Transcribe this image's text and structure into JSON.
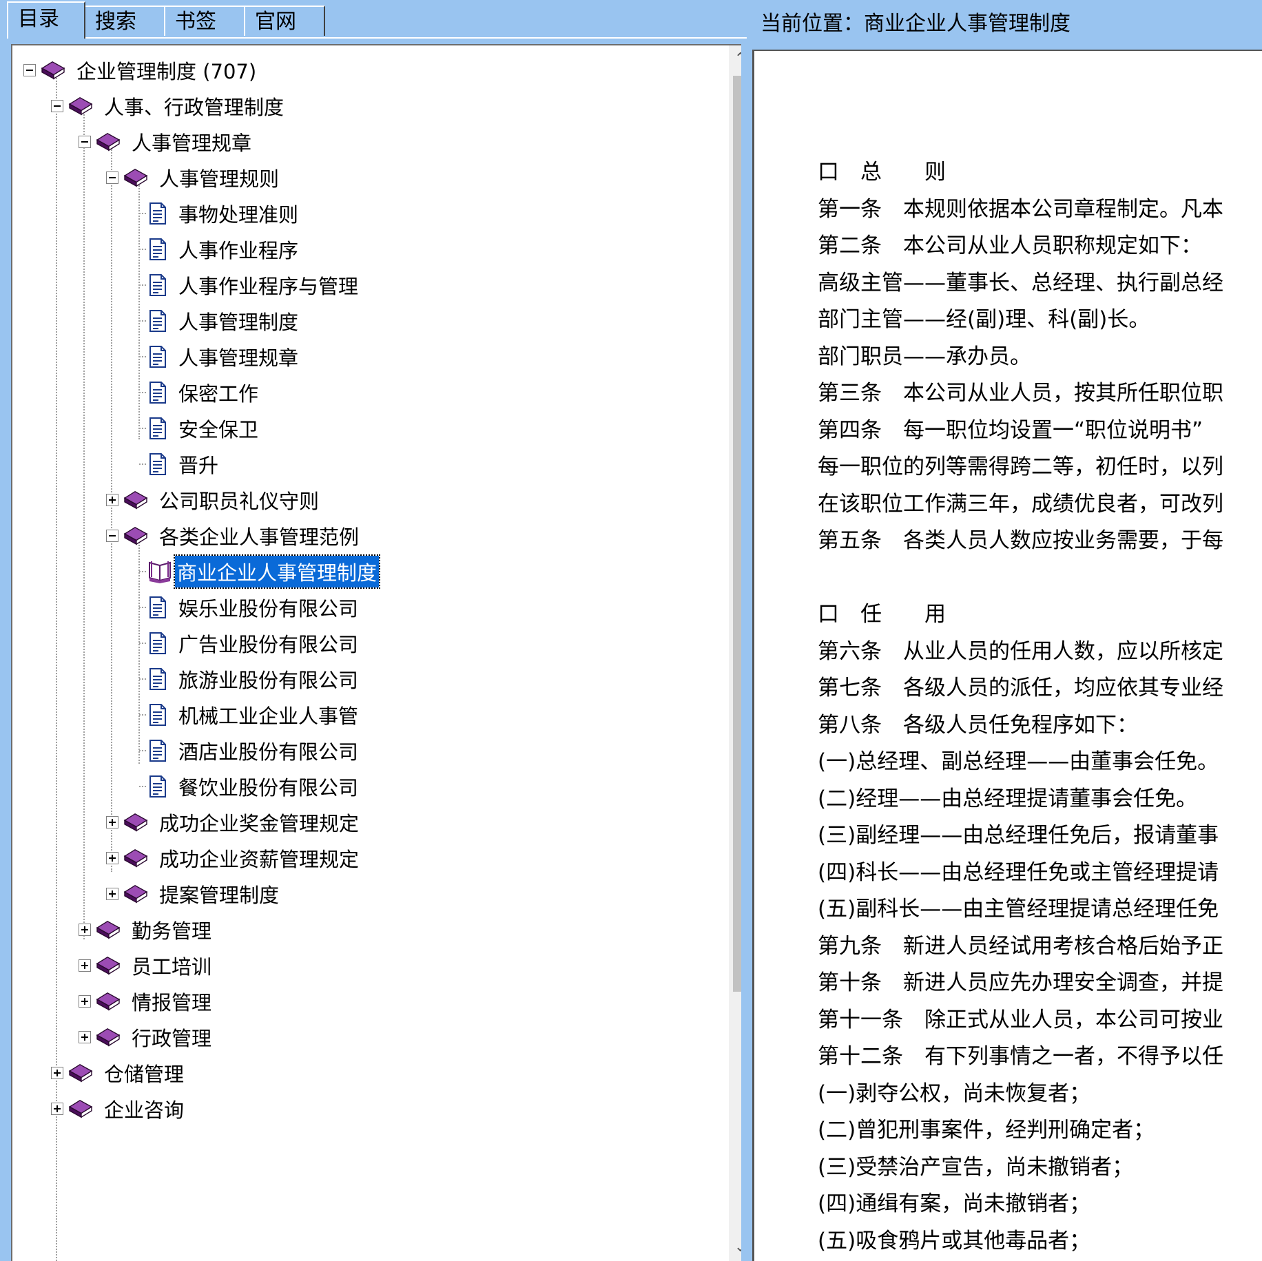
{
  "tabs": [
    {
      "label": "目录",
      "active": true
    },
    {
      "label": "搜索",
      "active": false
    },
    {
      "label": "书签",
      "active": false
    },
    {
      "label": "官网",
      "active": false
    }
  ],
  "location": {
    "prefix": "当前位置：",
    "title": "商业企业人事管理制度"
  },
  "tree": {
    "n0": "企业管理制度 (707)",
    "n1": "人事、行政管理制度",
    "n2": "人事管理规章",
    "n3": "人事管理规则",
    "n4": "事物处理准则",
    "n5": "人事作业程序",
    "n6": "人事作业程序与管理",
    "n7": "人事管理制度",
    "n8": "人事管理规章",
    "n9": "保密工作",
    "n10": "安全保卫",
    "n11": "晋升",
    "n12": "公司职员礼仪守则",
    "n13": "各类企业人事管理范例",
    "n14": "商业企业人事管理制度",
    "n15": "娱乐业股份有限公司",
    "n16": "广告业股份有限公司",
    "n17": "旅游业股份有限公司",
    "n18": "机械工业企业人事管",
    "n19": "酒店业股份有限公司",
    "n20": "餐饮业股份有限公司",
    "n21": "成功企业奖金管理规定",
    "n22": "成功企业资薪管理规定",
    "n23": "提案管理制度",
    "n24": "勤务管理",
    "n25": "员工培训",
    "n26": "情报管理",
    "n27": "行政管理",
    "n28": "仓储管理",
    "n29": "企业咨询"
  },
  "doc_lines": [
    "口　总　　则",
    "第一条　本规则依据本公司章程制定。凡本",
    "第二条　本公司从业人员职称规定如下：",
    "高级主管——董事长、总经理、执行副总经",
    "部门主管——经(副)理、科(副)长。",
    "部门职员——承办员。",
    "第三条　本公司从业人员，按其所任职位职",
    "第四条　每一职位均设置一“职位说明书”",
    "每一职位的列等需得跨二等，初任时，以列",
    "在该职位工作满三年，成绩优良者，可改列",
    "第五条　各类人员人数应按业务需要，于每",
    "",
    "口　任　　用",
    "第六条　从业人员的任用人数，应以所核定",
    "第七条　各级人员的派任，均应依其专业经",
    "第八条　各级人员任免程序如下：",
    "(一)总经理、副总经理——由董事会任免。",
    "(二)经理——由总经理提请董事会任免。",
    "(三)副经理——由总经理任免后，报请董事",
    "(四)科长——由总经理任免或主管经理提请",
    "(五)副科长——由主管经理提请总经理任免",
    "第九条　新进人员经试用考核合格后始予正",
    "第十条　新进人员应先办理安全调查，并提",
    "第十一条　除正式从业人员，本公司可按业",
    "第十二条　有下列事情之一者，不得予以任",
    "(一)剥夺公权，尚未恢复者；",
    "(二)曾犯刑事案件，经判刑确定者；",
    "(三)受禁治产宣告，尚未撤销者；",
    "(四)通缉有案，尚未撤销者；",
    "(五)吸食鸦片或其他毒品者；"
  ],
  "colors": {
    "panel": "#99c4f0",
    "book": "#6a1d7a",
    "selection": "#0a6ad8"
  }
}
